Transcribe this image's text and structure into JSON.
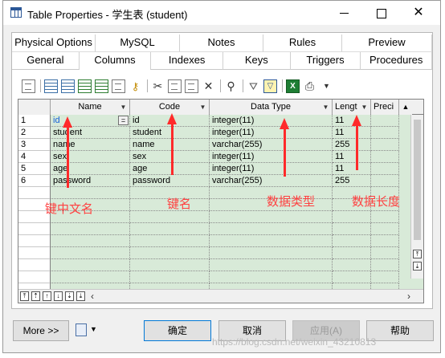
{
  "window": {
    "title": "Table Properties - 学生表 (student)"
  },
  "tabs": {
    "row1": [
      "Physical Options",
      "MySQL",
      "Notes",
      "Rules",
      "Preview"
    ],
    "row2": [
      "General",
      "Columns",
      "Indexes",
      "Keys",
      "Triggers",
      "Procedures"
    ],
    "active": "Columns"
  },
  "grid": {
    "headers": [
      "Name",
      "Code",
      "Data Type",
      "Lengt",
      "Preci"
    ],
    "rows": [
      {
        "num": "1",
        "name": "id",
        "code": "id",
        "type": "integer(11)",
        "length": "11"
      },
      {
        "num": "2",
        "name": "student",
        "code": "student",
        "type": "integer(11)",
        "length": "11"
      },
      {
        "num": "3",
        "name": "name",
        "code": "name",
        "type": "varchar(255)",
        "length": "255"
      },
      {
        "num": "4",
        "name": "sex",
        "code": "sex",
        "type": "integer(11)",
        "length": "11"
      },
      {
        "num": "5",
        "name": "age",
        "code": "age",
        "type": "integer(11)",
        "length": "11"
      },
      {
        "num": "6",
        "name": "password",
        "code": "password",
        "type": "varchar(255)",
        "length": "255"
      }
    ],
    "edit_button_label": "="
  },
  "annotations": {
    "name": "键中文名",
    "code": "键名",
    "type": "数据类型",
    "length": "数据长度"
  },
  "buttons": {
    "more": "More >>",
    "ok": "确定",
    "cancel": "取消",
    "apply": "应用(A)",
    "help": "帮助"
  },
  "watermark": "https://blog.csdn.net/weixin_43210813",
  "colors": {
    "grid_bg": "#d8ead8",
    "annotation": "#ff2a2a",
    "selected_text": "#1560d8"
  },
  "icons": {
    "window": "table-icon",
    "toolbar": [
      "properties-icon",
      "insert-row-icon",
      "add-row-icon",
      "insert-column-icon",
      "add-column-icon",
      "key-icon",
      "cut-icon",
      "copy-icon",
      "paste-icon",
      "delete-icon",
      "find-icon",
      "filter-icon",
      "filter-active-icon",
      "excel-icon",
      "print-icon"
    ]
  }
}
